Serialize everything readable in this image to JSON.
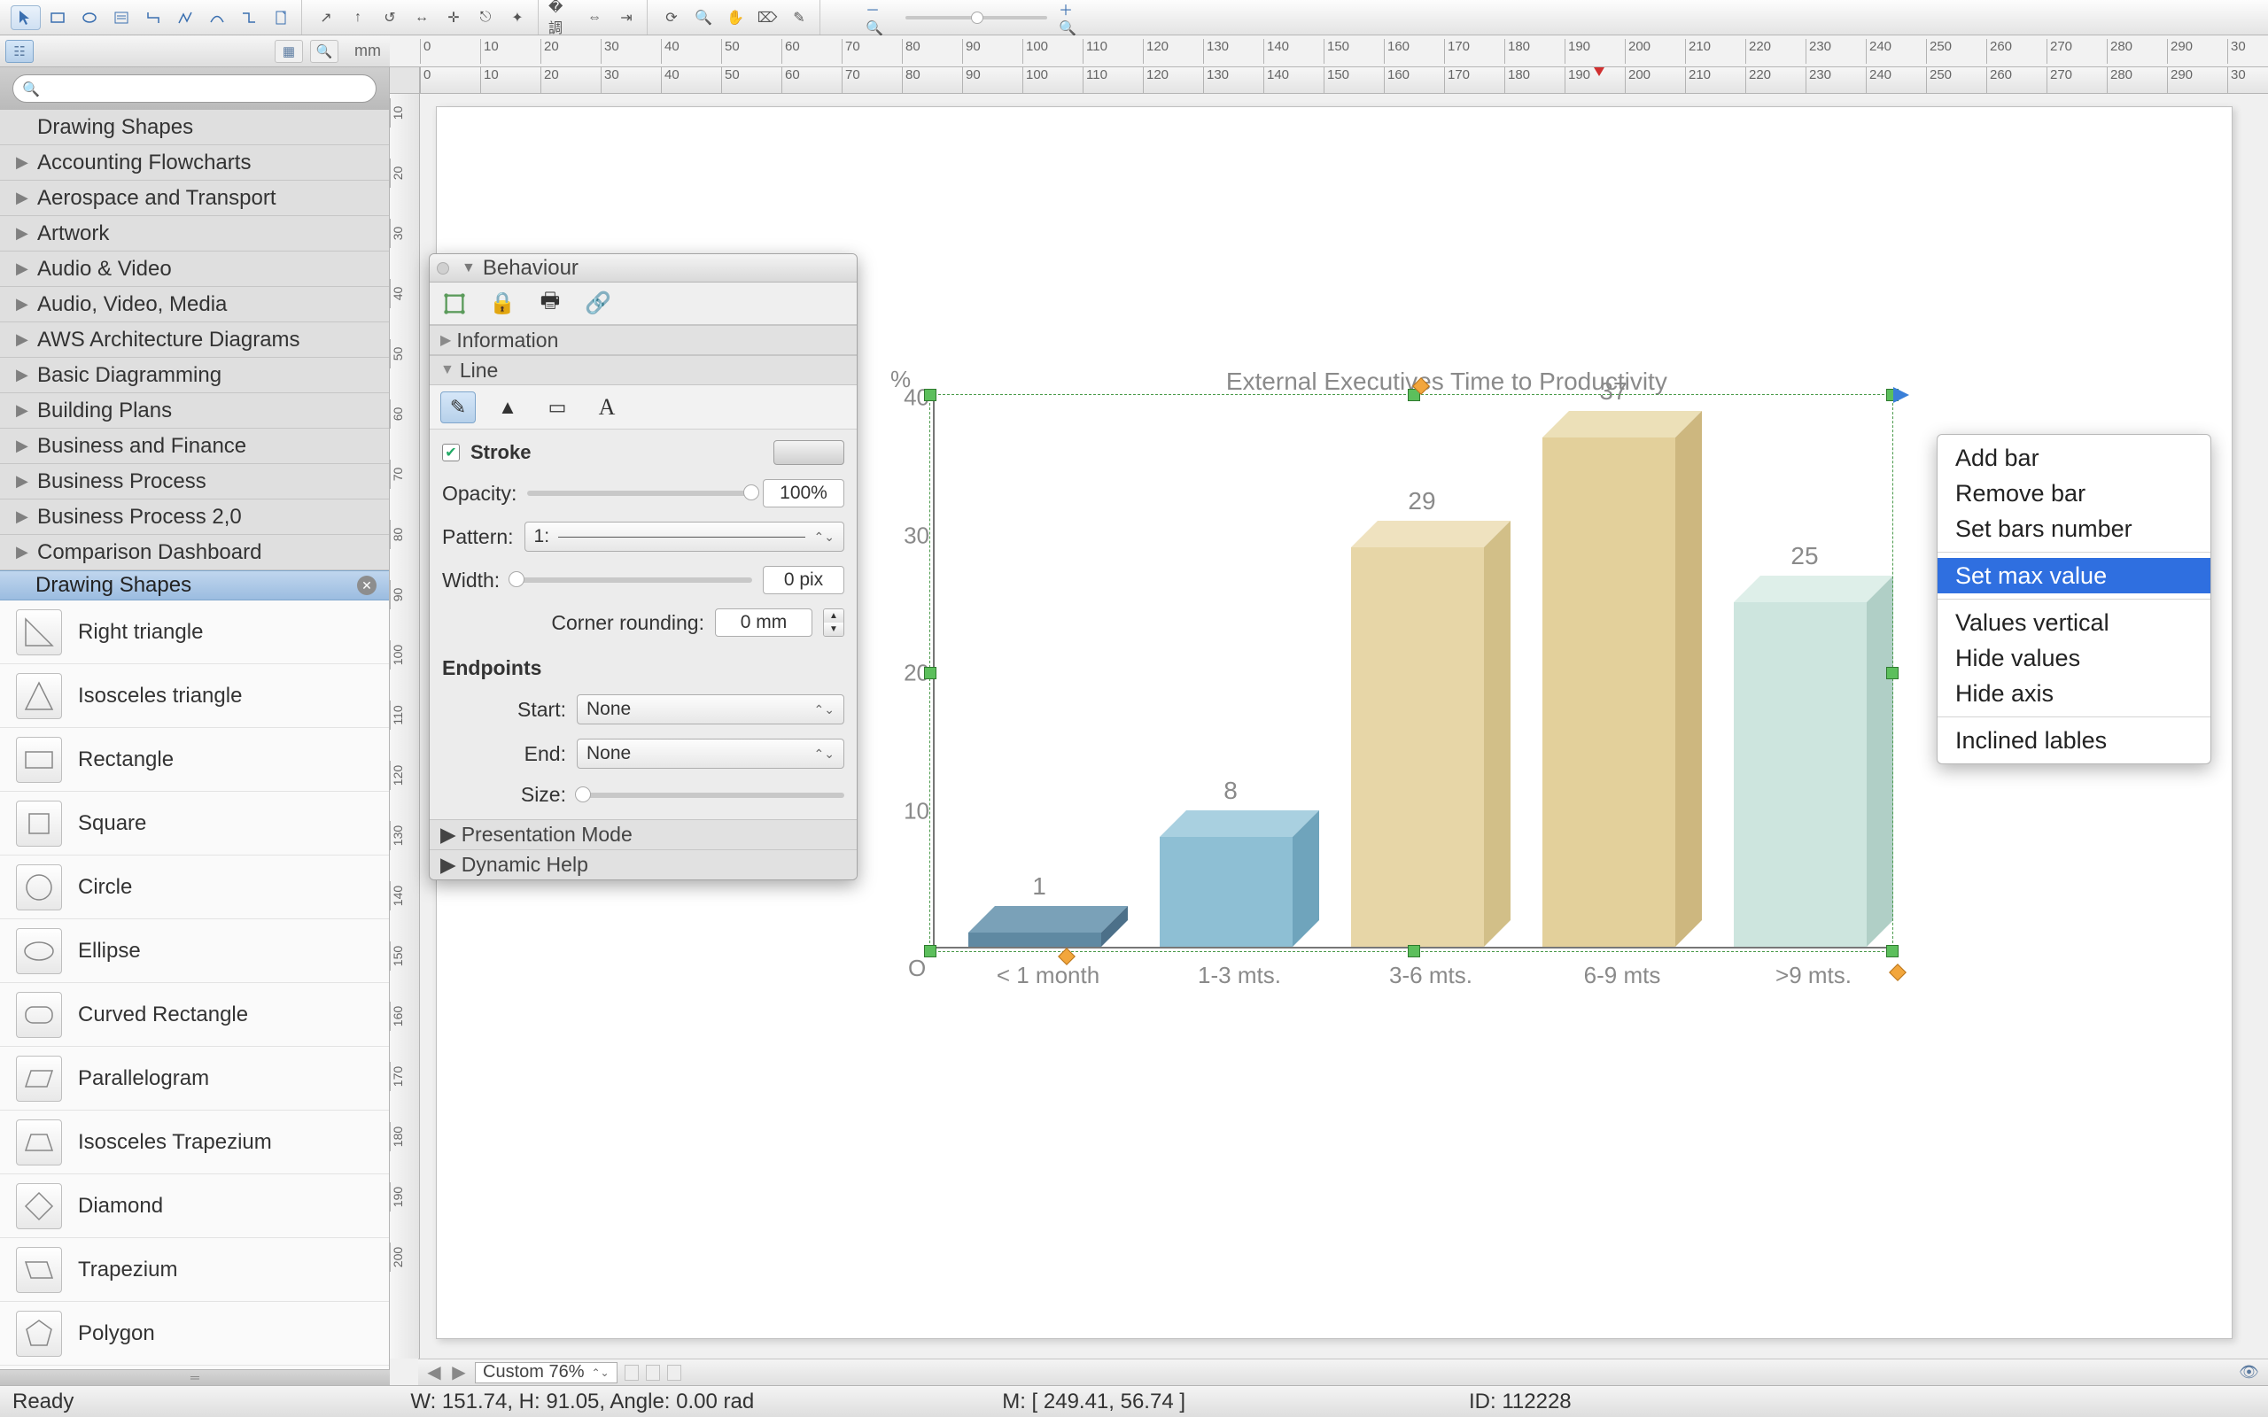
{
  "toolbar": {
    "groups": [
      [
        "cursor",
        "rect-tool",
        "ellipse-tool",
        "text-block",
        "connector-l",
        "connector-poly",
        "connector-curve",
        "connector-step",
        "page-icon"
      ],
      [
        "arrow-ne",
        "arrow-up",
        "arrow-curve",
        "arrow-both",
        "arrow-cross",
        "arrow-x",
        "crosshair"
      ],
      [
        "align-left",
        "align-center",
        "align-right"
      ],
      [
        "refresh",
        "zoom-tool",
        "hand-tool",
        "stamp",
        "eyedropper"
      ]
    ],
    "zoom_out_icon": "zoom-out",
    "zoom_in_icon": "zoom-in"
  },
  "secbar": {
    "tree_icon": "tree",
    "grid_icon": "grid",
    "search_icon": "search",
    "unit_label": "mm"
  },
  "ruler_ticks": [
    "0",
    "10",
    "20",
    "30",
    "40",
    "50",
    "60",
    "70",
    "80",
    "90",
    "100",
    "110",
    "120",
    "130",
    "140",
    "150",
    "160",
    "170",
    "180",
    "190",
    "200",
    "210",
    "220",
    "230",
    "240",
    "250",
    "260",
    "270",
    "280",
    "290",
    "30"
  ],
  "ruler_marker_at": 195.67,
  "vruler_ticks": [
    "10",
    "20",
    "30",
    "40",
    "50",
    "60",
    "70",
    "80",
    "90",
    "100",
    "110",
    "120",
    "130",
    "140",
    "150",
    "160",
    "170",
    "180",
    "190",
    "200"
  ],
  "library": {
    "search_placeholder": "",
    "tree": [
      {
        "label": "Drawing Shapes",
        "expandable": false
      },
      {
        "label": "Accounting Flowcharts",
        "expandable": true
      },
      {
        "label": "Aerospace and Transport",
        "expandable": true
      },
      {
        "label": "Artwork",
        "expandable": true
      },
      {
        "label": "Audio & Video",
        "expandable": true
      },
      {
        "label": "Audio, Video, Media",
        "expandable": true
      },
      {
        "label": "AWS Architecture Diagrams",
        "expandable": true
      },
      {
        "label": "Basic Diagramming",
        "expandable": true
      },
      {
        "label": "Building Plans",
        "expandable": true
      },
      {
        "label": "Business and Finance",
        "expandable": true
      },
      {
        "label": "Business Process",
        "expandable": true
      },
      {
        "label": "Business Process 2,0",
        "expandable": true
      },
      {
        "label": "Comparison Dashboard",
        "expandable": true
      }
    ],
    "active_header": "Drawing Shapes",
    "shapes": [
      {
        "label": "Right triangle",
        "kind": "right-triangle"
      },
      {
        "label": "Isosceles triangle",
        "kind": "iso-triangle"
      },
      {
        "label": "Rectangle",
        "kind": "rect"
      },
      {
        "label": "Square",
        "kind": "square"
      },
      {
        "label": "Circle",
        "kind": "circle"
      },
      {
        "label": "Ellipse",
        "kind": "ellipse"
      },
      {
        "label": "Curved Rectangle",
        "kind": "curved-rect"
      },
      {
        "label": "Parallelogram",
        "kind": "para"
      },
      {
        "label": "Isosceles Trapezium",
        "kind": "iso-trap"
      },
      {
        "label": "Diamond",
        "kind": "diamond"
      },
      {
        "label": "Trapezium",
        "kind": "trap"
      },
      {
        "label": "Polygon",
        "kind": "poly"
      }
    ]
  },
  "prop_panel": {
    "behaviour_label": "Behaviour",
    "information_label": "Information",
    "line_label": "Line",
    "stroke_label": "Stroke",
    "stroke_checked": true,
    "opacity_label": "Opacity:",
    "opacity_value": "100%",
    "pattern_label": "Pattern:",
    "pattern_value": "1:",
    "width_label": "Width:",
    "width_value": "0 pix",
    "corner_label": "Corner rounding:",
    "corner_value": "0 mm",
    "endpoints_label": "Endpoints",
    "start_label": "Start:",
    "start_value": "None",
    "end_label": "End:",
    "end_value": "None",
    "size_label": "Size:",
    "presentation_label": "Presentation Mode",
    "dynamic_help_label": "Dynamic Help"
  },
  "context_menu": {
    "items": [
      {
        "label": "Add bar",
        "selected": false
      },
      {
        "label": "Remove bar",
        "selected": false
      },
      {
        "label": "Set bars number",
        "selected": false
      },
      {
        "sep": true
      },
      {
        "label": "Set max value",
        "selected": true
      },
      {
        "sep": true
      },
      {
        "label": "Values vertical",
        "selected": false
      },
      {
        "label": "Hide values",
        "selected": false
      },
      {
        "label": "Hide axis",
        "selected": false
      },
      {
        "sep": true
      },
      {
        "label": "Inclined lables",
        "selected": false
      }
    ]
  },
  "zoom_row": {
    "zoom_label": "Custom 76%"
  },
  "status": {
    "ready": "Ready",
    "dims": "W: 151.74,  H: 91.05,  Angle: 0.00 rad",
    "mouse": "M: [ 249.41, 56.74 ]",
    "id": "ID: 112228"
  },
  "chart_data": {
    "type": "bar",
    "title": "External Executives Time to Productivity",
    "yaxis_unit": "%",
    "origin_label": "O",
    "categories": [
      "< 1 month",
      "1-3 mts.",
      "3-6 mts.",
      "6-9 mts",
      ">9 mts."
    ],
    "values": [
      1,
      8,
      29,
      37,
      25
    ],
    "yticks": [
      10,
      20,
      30,
      40
    ],
    "ylim": [
      0,
      40
    ],
    "bar_colors": [
      {
        "front": "#5f89a2",
        "top": "#7aa1b8",
        "side": "#4c7089"
      },
      {
        "front": "#8ebfd4",
        "top": "#a9d0e0",
        "side": "#6fa4bc"
      },
      {
        "front": "#e7d6a7",
        "top": "#efe2bf",
        "side": "#d2bf88"
      },
      {
        "front": "#e3d09b",
        "top": "#ece0b8",
        "side": "#cdb77f"
      },
      {
        "front": "#cde5de",
        "top": "#deefe9",
        "side": "#b0cfc6"
      }
    ]
  }
}
